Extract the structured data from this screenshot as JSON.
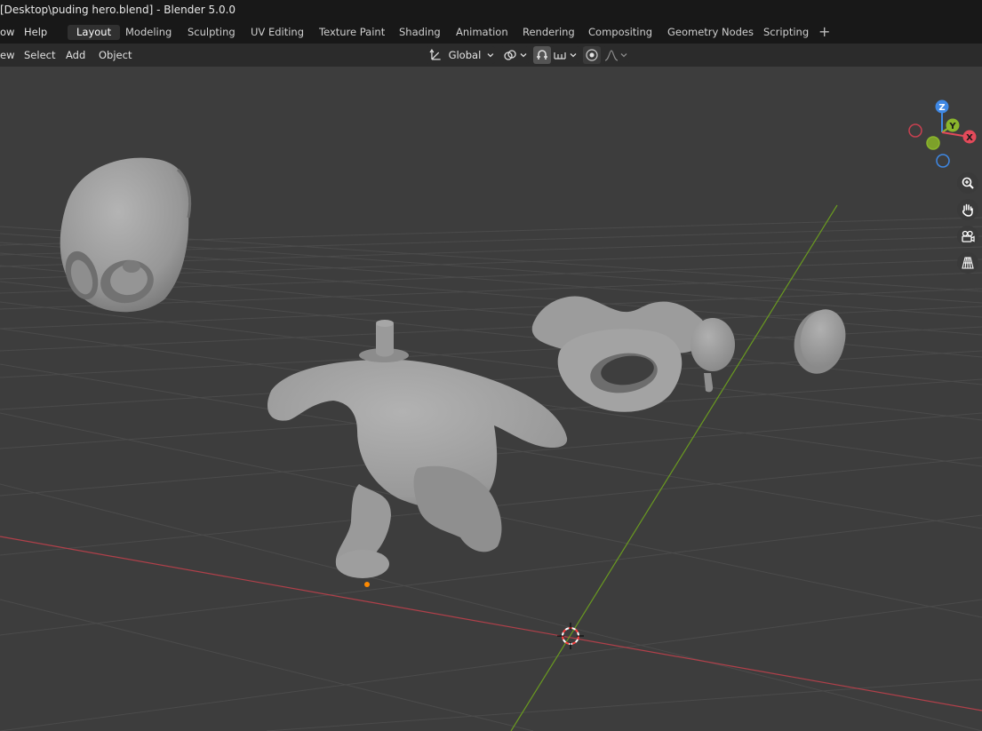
{
  "window": {
    "title": "[Desktop\\puding hero.blend] - Blender 5.0.0"
  },
  "menu": {
    "items": [
      "ow",
      "Help"
    ]
  },
  "workspaces": {
    "tabs": [
      "Layout",
      "Modeling",
      "Sculpting",
      "UV Editing",
      "Texture Paint",
      "Shading",
      "Animation",
      "Rendering",
      "Compositing",
      "Geometry Nodes",
      "Scripting"
    ],
    "active": "Layout",
    "add_icon": "plus-icon"
  },
  "viewport_header": {
    "menus": [
      "ew",
      "Select",
      "Add",
      "Object"
    ],
    "transform_orientation": "Global",
    "icons": [
      "transform-orientation-icon",
      "pivot-link-icon",
      "snap-icon",
      "snap-increment-icon",
      "proportional-edit-icon",
      "falloff-icon"
    ]
  },
  "gizmo": {
    "axes": {
      "x": "X",
      "y": "Y",
      "z": "Z"
    },
    "colors": {
      "x": "#e34a5a",
      "y": "#8bb62c",
      "z": "#3f88e4"
    }
  },
  "nav_buttons": [
    "zoom-icon",
    "pan-hand-icon",
    "camera-icon",
    "grid-perspective-icon"
  ],
  "colors": {
    "background": "#3d3d3d",
    "grid": "#4a4a4a",
    "x_axis": "#b0404a",
    "y_axis": "#6a9a20",
    "mesh": "#9c9c9c",
    "origin": "#ff8a00"
  }
}
